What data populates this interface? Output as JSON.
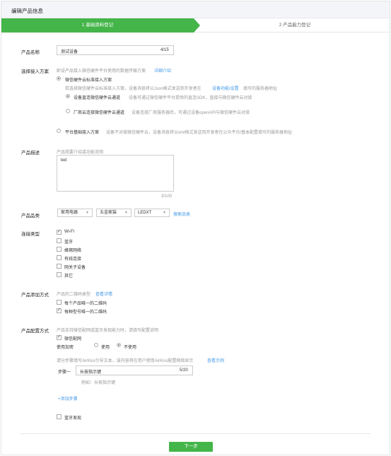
{
  "header": {
    "title": "编辑产品信息"
  },
  "steps": {
    "step1": "1 基础资料登记",
    "step2": "2 产品能力登记"
  },
  "product_name": {
    "label": "产品名称",
    "value": "测试设备",
    "count": "4/15"
  },
  "access": {
    "label": "选择接入方案",
    "desc": "即设产品接入微信硬件平台使用的数据传输方案",
    "desc_link": "详细介绍",
    "opt1": "微信硬件云标准接入方案",
    "opt1_desc": "若选择微信硬件云标准接入方案，设备消息将以Json格式发送到开发者在",
    "opt1_link": "设备功能/设置",
    "opt1_desc2": "填写的服务器地址",
    "sub1": "设备直连微信硬件云通道",
    "sub1_desc": "设备可通过微信硬件平台提供的直连SDK，直接与微信硬件云对接",
    "sub2": "厂商云连接微信硬件云通道",
    "sub2_desc": "设备连接厂商服务器后，可通过设备openAPI与微信硬件云对接",
    "opt2": "平台基础接入方案",
    "opt2_desc": "设备不对接微信硬件云，设备消息将以xml格式发送到开发者在公众平台/基本配置填写的服务器地址"
  },
  "description": {
    "label": "产品描述",
    "hint": "产品简要介绍或功能说明",
    "value": "led",
    "count": "3/100"
  },
  "category": {
    "label": "产品品类",
    "sel1": "家用电器",
    "sel2": "五金家装",
    "sel3": "LEDXT",
    "link": "搜索品类"
  },
  "connect": {
    "label": "连接类型",
    "items": [
      {
        "label": "Wi-Fi",
        "checked": true
      },
      {
        "label": "蓝牙",
        "checked": false
      },
      {
        "label": "蜂窝网络",
        "checked": false
      },
      {
        "label": "有线连接",
        "checked": false
      },
      {
        "label": "网关子设备",
        "checked": false
      },
      {
        "label": "其它",
        "checked": false
      }
    ]
  },
  "add_method": {
    "label": "产品添加方式",
    "desc": "产品的二维码类型",
    "link": "查看详情",
    "opt1": "每个产品唯一的二维码",
    "opt2": "每种型号唯一的二维码"
  },
  "config": {
    "label": "产品配置方式",
    "desc": "产品支持微信配网或蓝牙发现能力时，请填写配置说明",
    "wechat": "微信配网",
    "encrypt_label": "使用加密",
    "use": "使用",
    "not_use": "不使用",
    "airkiss_desc": "请分步骤填写AirKiss引导文本，该内容将在用户使用AirKiss配置网络显示",
    "airkiss_link": "查看示例",
    "step_label": "步骤一",
    "step_value": "长按指示键",
    "step_count": "5/20",
    "example": "例如：长按指示键",
    "add_step": "+添加步骤",
    "bt_discover": "蓝牙发现"
  },
  "next_button": "下一步",
  "accent_color": "#44b549"
}
